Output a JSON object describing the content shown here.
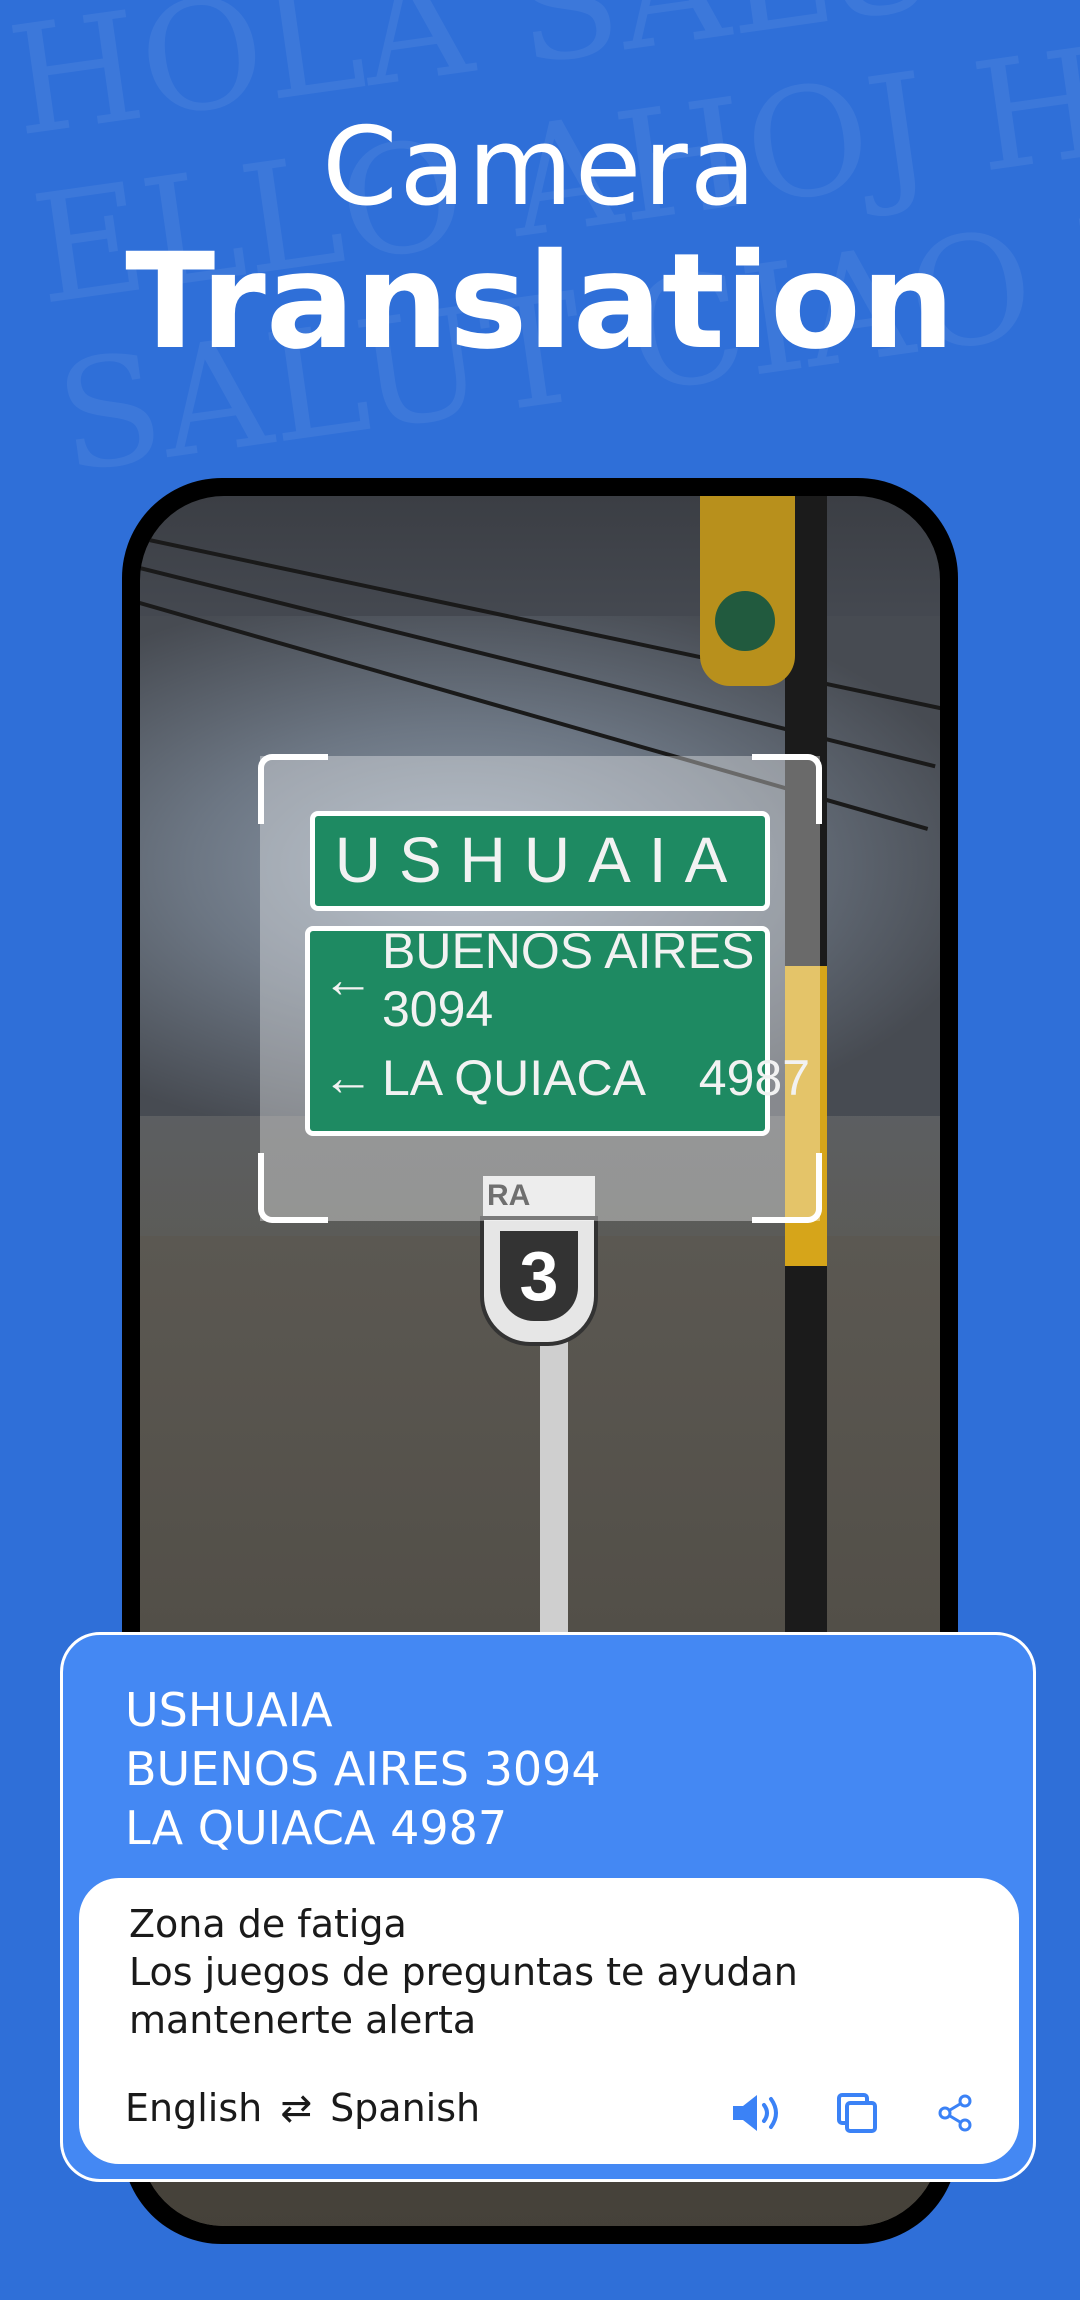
{
  "hero": {
    "title_line1": "Camera",
    "title_line2": "Translation"
  },
  "camera_view": {
    "sign_top": "USHUAIA",
    "sign_rows": [
      {
        "arrow": "←",
        "text": "BUENOS AIRES 3094"
      },
      {
        "arrow": "←",
        "text": "LA QUIACA    4987"
      }
    ],
    "route_tag": "RA",
    "route_number": "3"
  },
  "result": {
    "source_text": "USHUAIA\nBUENOS AIRES 3094\nLA QUIACA 4987",
    "translated_text": "Zona de fatiga\nLos juegos de preguntas te ayudan\nmantenerte alerta",
    "source_language": "English",
    "target_language": "Spanish",
    "icons": {
      "swap": "swap-arrows-icon",
      "speak": "speaker-icon",
      "copy": "copy-icon",
      "share": "share-icon"
    }
  },
  "colors": {
    "background": "#2f6fd8",
    "card": "#4488f3",
    "accent_icon": "#3b82f6"
  }
}
